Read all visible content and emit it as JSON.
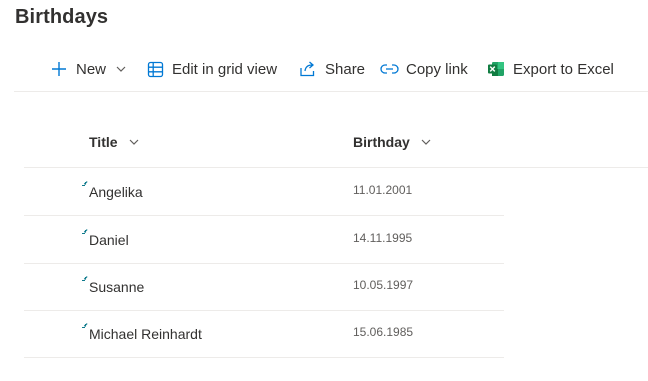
{
  "page": {
    "title": "Birthdays"
  },
  "toolbar": {
    "new_label": "New",
    "edit_grid_label": "Edit in grid view",
    "share_label": "Share",
    "copy_link_label": "Copy link",
    "export_label": "Export to Excel"
  },
  "columns": {
    "title": "Title",
    "birthday": "Birthday"
  },
  "rows": [
    {
      "title": "Angelika",
      "birthday": "11.01.2001"
    },
    {
      "title": "Daniel",
      "birthday": "14.11.1995"
    },
    {
      "title": "Susanne",
      "birthday": "10.05.1997"
    },
    {
      "title": "Michael Reinhardt",
      "birthday": "15.06.1985"
    }
  ],
  "icons": {
    "new": "plus-icon",
    "edit_grid": "grid-icon",
    "share": "share-icon",
    "copy_link": "link-icon",
    "export": "excel-icon",
    "sort": "chevron-down-icon",
    "new_item": "new-item-indicator-icon"
  },
  "colors": {
    "accent": "#0078d4",
    "excel_green": "#107c41",
    "new_indicator": "#0e7a8c",
    "text": "#323130",
    "subtle_text": "#605e5c",
    "divider": "#edebe9"
  }
}
